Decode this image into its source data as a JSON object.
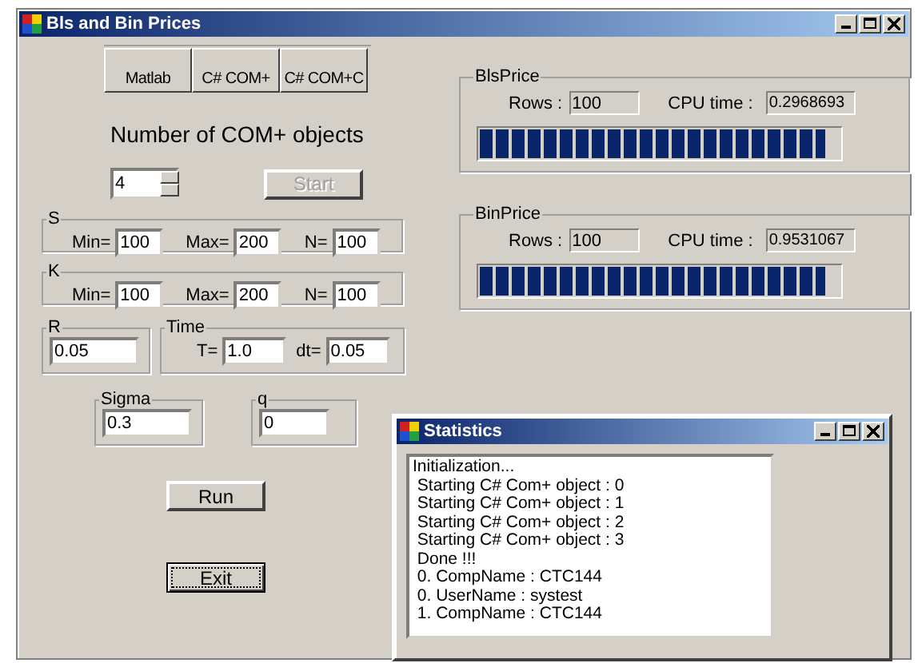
{
  "window": {
    "title": "Bls and Bin Prices"
  },
  "mode_buttons": [
    {
      "label": "Matlab"
    },
    {
      "label": "C# COM+"
    },
    {
      "label": "C# COM+C"
    }
  ],
  "heading": "Number of COM+ objects",
  "spinner": {
    "value": "4"
  },
  "start_button": {
    "label": "Start",
    "disabled": true
  },
  "range_groups": [
    {
      "title": "S",
      "fields": [
        {
          "label": "Min=",
          "value": "100"
        },
        {
          "label": "Max=",
          "value": "200"
        },
        {
          "label": "N=",
          "value": "100"
        }
      ]
    },
    {
      "title": "K",
      "fields": [
        {
          "label": "Min=",
          "value": "100"
        },
        {
          "label": "Max=",
          "value": "200"
        },
        {
          "label": "N=",
          "value": "100"
        }
      ]
    }
  ],
  "param_rows": [
    [
      {
        "title": "R",
        "fields": [
          {
            "value": "0.05"
          }
        ]
      },
      {
        "title": "Time",
        "fields": [
          {
            "label": "T=",
            "value": "1.0"
          },
          {
            "label": "dt=",
            "value": "0.05"
          }
        ]
      }
    ],
    [
      {
        "title": "Sigma",
        "fields": [
          {
            "value": "0.3"
          }
        ]
      },
      {
        "title": "q",
        "fields": [
          {
            "value": "0"
          }
        ]
      }
    ]
  ],
  "run_button": {
    "label": "Run"
  },
  "exit_button": {
    "label": "Exit",
    "focused": true
  },
  "results": [
    {
      "title": "BlsPrice",
      "rows_label": "Rows :",
      "rows": "100",
      "cpu_label": "CPU time :",
      "cpu_time": "0.2968693",
      "level": 0.96
    },
    {
      "title": "BinPrice",
      "rows_label": "Rows :",
      "rows": "100",
      "cpu_label": "CPU time :",
      "cpu_time": "0.9531067",
      "level": 0.96
    }
  ],
  "statistics_window": {
    "title": "Statistics",
    "lines": [
      "Initialization...",
      " Starting C# Com+ object : 0",
      " Starting C# Com+ object : 1",
      " Starting C# Com+ object : 2",
      " Starting C# Com+ object : 3",
      " Done !!!",
      " 0. CompName : CTC144",
      " 0. UserName : systest",
      " 1. CompName : CTC144"
    ]
  }
}
